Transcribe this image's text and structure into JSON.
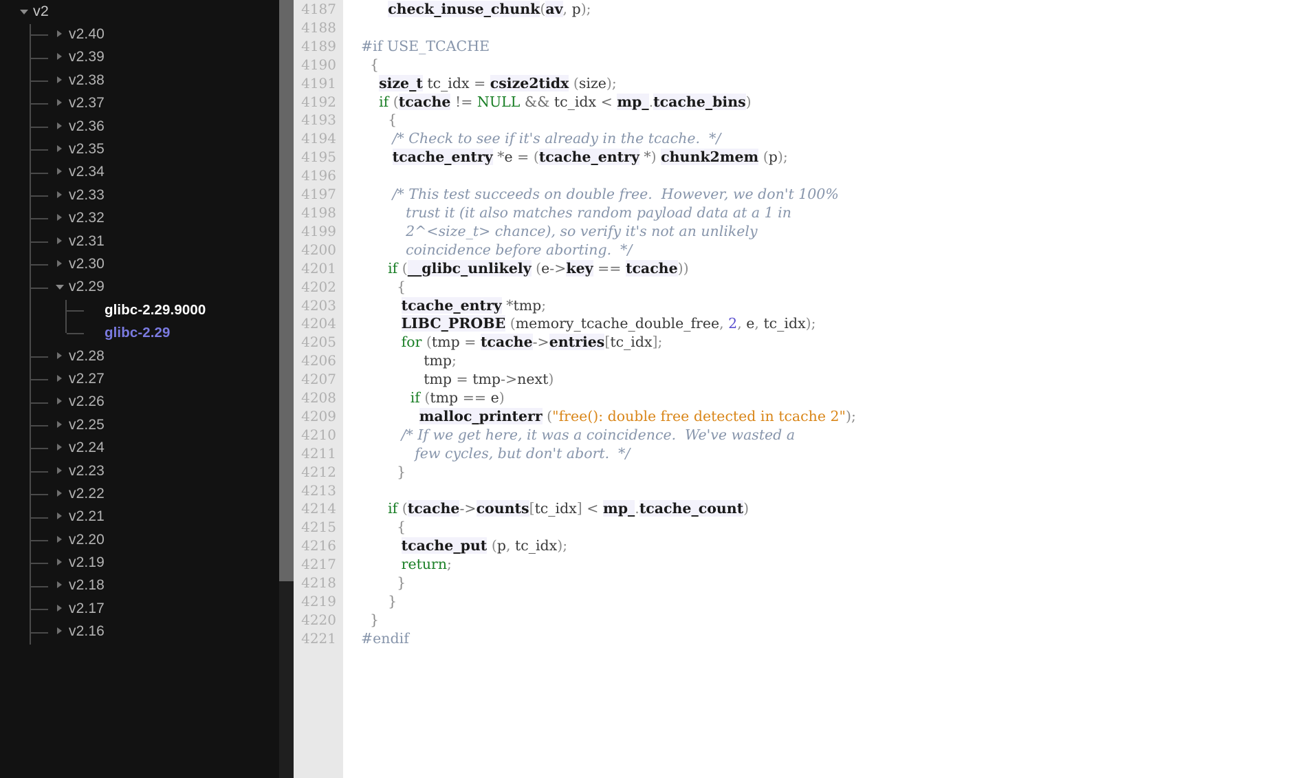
{
  "sidebar": {
    "name": "version-tree",
    "scrollbar": {
      "thumb_color": "#666666",
      "track_color": "#1f1f1f"
    },
    "items": [
      {
        "label": "v2",
        "depth": 0,
        "state": "open",
        "kind": "branch"
      },
      {
        "label": "v2.40",
        "depth": 1,
        "state": "closed",
        "kind": "branch"
      },
      {
        "label": "v2.39",
        "depth": 1,
        "state": "closed",
        "kind": "branch"
      },
      {
        "label": "v2.38",
        "depth": 1,
        "state": "closed",
        "kind": "branch"
      },
      {
        "label": "v2.37",
        "depth": 1,
        "state": "closed",
        "kind": "branch"
      },
      {
        "label": "v2.36",
        "depth": 1,
        "state": "closed",
        "kind": "branch"
      },
      {
        "label": "v2.35",
        "depth": 1,
        "state": "closed",
        "kind": "branch"
      },
      {
        "label": "v2.34",
        "depth": 1,
        "state": "closed",
        "kind": "branch"
      },
      {
        "label": "v2.33",
        "depth": 1,
        "state": "closed",
        "kind": "branch"
      },
      {
        "label": "v2.32",
        "depth": 1,
        "state": "closed",
        "kind": "branch"
      },
      {
        "label": "v2.31",
        "depth": 1,
        "state": "closed",
        "kind": "branch"
      },
      {
        "label": "v2.30",
        "depth": 1,
        "state": "closed",
        "kind": "branch"
      },
      {
        "label": "v2.29",
        "depth": 1,
        "state": "open",
        "kind": "branch"
      },
      {
        "label": "glibc-2.29.9000",
        "depth": 2,
        "state": "none",
        "kind": "leaf"
      },
      {
        "label": "glibc-2.29",
        "depth": 2,
        "state": "none",
        "kind": "leaf",
        "selected": true
      },
      {
        "label": "v2.28",
        "depth": 1,
        "state": "closed",
        "kind": "branch"
      },
      {
        "label": "v2.27",
        "depth": 1,
        "state": "closed",
        "kind": "branch"
      },
      {
        "label": "v2.26",
        "depth": 1,
        "state": "closed",
        "kind": "branch"
      },
      {
        "label": "v2.25",
        "depth": 1,
        "state": "closed",
        "kind": "branch"
      },
      {
        "label": "v2.24",
        "depth": 1,
        "state": "closed",
        "kind": "branch"
      },
      {
        "label": "v2.23",
        "depth": 1,
        "state": "closed",
        "kind": "branch"
      },
      {
        "label": "v2.22",
        "depth": 1,
        "state": "closed",
        "kind": "branch"
      },
      {
        "label": "v2.21",
        "depth": 1,
        "state": "closed",
        "kind": "branch"
      },
      {
        "label": "v2.20",
        "depth": 1,
        "state": "closed",
        "kind": "branch"
      },
      {
        "label": "v2.19",
        "depth": 1,
        "state": "closed",
        "kind": "branch"
      },
      {
        "label": "v2.18",
        "depth": 1,
        "state": "closed",
        "kind": "branch"
      },
      {
        "label": "v2.17",
        "depth": 1,
        "state": "closed",
        "kind": "branch"
      },
      {
        "label": "v2.16",
        "depth": 1,
        "state": "closed",
        "kind": "branch"
      }
    ]
  },
  "editor": {
    "first_line_number": 4187,
    "last_line_number": 4221,
    "colors": {
      "gutter_bg": "#e8e8e8",
      "line_number": "#b0b0b0",
      "code_bg": "#ffffff",
      "keyword": "#1a7f26",
      "preprocessor": "#8795ab",
      "comment": "#8795ab",
      "string": "#d98619",
      "number": "#5a4fcf",
      "identifier_bg": "#f3f2fb"
    },
    "lines": [
      {
        "n": 4187,
        "tokens": [
          {
            "t": "plain",
            "v": "      "
          },
          {
            "t": "id",
            "v": "check_inuse_chunk"
          },
          {
            "t": "punct",
            "v": "("
          },
          {
            "t": "id",
            "v": "av"
          },
          {
            "t": "punct",
            "v": ", "
          },
          {
            "t": "plain",
            "v": "p"
          },
          {
            "t": "punct",
            "v": ");"
          }
        ]
      },
      {
        "n": 4188,
        "tokens": []
      },
      {
        "n": 4189,
        "tokens": [
          {
            "t": "pre",
            "v": "#if USE_TCACHE"
          }
        ]
      },
      {
        "n": 4190,
        "tokens": [
          {
            "t": "punct",
            "v": "  {"
          }
        ]
      },
      {
        "n": 4191,
        "tokens": [
          {
            "t": "plain",
            "v": "    "
          },
          {
            "t": "id",
            "v": "size_t"
          },
          {
            "t": "plain",
            "v": " tc_idx "
          },
          {
            "t": "op",
            "v": "= "
          },
          {
            "t": "id",
            "v": "csize2tidx"
          },
          {
            "t": "plain",
            "v": " "
          },
          {
            "t": "punct",
            "v": "("
          },
          {
            "t": "plain",
            "v": "size"
          },
          {
            "t": "punct",
            "v": ");"
          }
        ]
      },
      {
        "n": 4192,
        "tokens": [
          {
            "t": "plain",
            "v": "    "
          },
          {
            "t": "kw",
            "v": "if"
          },
          {
            "t": "plain",
            "v": " "
          },
          {
            "t": "punct",
            "v": "("
          },
          {
            "t": "id",
            "v": "tcache"
          },
          {
            "t": "plain",
            "v": " "
          },
          {
            "t": "op",
            "v": "!= "
          },
          {
            "t": "kw",
            "v": "NULL"
          },
          {
            "t": "plain",
            "v": " "
          },
          {
            "t": "op",
            "v": "&& "
          },
          {
            "t": "plain",
            "v": "tc_idx "
          },
          {
            "t": "op",
            "v": "< "
          },
          {
            "t": "id",
            "v": "mp_"
          },
          {
            "t": "punct",
            "v": "."
          },
          {
            "t": "id",
            "v": "tcache_bins"
          },
          {
            "t": "punct",
            "v": ")"
          }
        ]
      },
      {
        "n": 4193,
        "tokens": [
          {
            "t": "punct",
            "v": "      {"
          }
        ]
      },
      {
        "n": 4194,
        "tokens": [
          {
            "t": "plain",
            "v": "       "
          },
          {
            "t": "cmt",
            "v": "/* Check to see if it's already in the tcache.  */"
          }
        ]
      },
      {
        "n": 4195,
        "tokens": [
          {
            "t": "plain",
            "v": "       "
          },
          {
            "t": "id",
            "v": "tcache_entry"
          },
          {
            "t": "plain",
            "v": " "
          },
          {
            "t": "op",
            "v": "*"
          },
          {
            "t": "plain",
            "v": "e "
          },
          {
            "t": "op",
            "v": "= "
          },
          {
            "t": "punct",
            "v": "("
          },
          {
            "t": "id",
            "v": "tcache_entry"
          },
          {
            "t": "plain",
            "v": " "
          },
          {
            "t": "op",
            "v": "*"
          },
          {
            "t": "punct",
            "v": ") "
          },
          {
            "t": "id",
            "v": "chunk2mem"
          },
          {
            "t": "plain",
            "v": " "
          },
          {
            "t": "punct",
            "v": "("
          },
          {
            "t": "plain",
            "v": "p"
          },
          {
            "t": "punct",
            "v": ");"
          }
        ]
      },
      {
        "n": 4196,
        "tokens": []
      },
      {
        "n": 4197,
        "tokens": [
          {
            "t": "plain",
            "v": "       "
          },
          {
            "t": "cmt",
            "v": "/* This test succeeds on double free.  However, we don't 100%"
          }
        ]
      },
      {
        "n": 4198,
        "tokens": [
          {
            "t": "plain",
            "v": "          "
          },
          {
            "t": "cmt",
            "v": "trust it (it also matches random payload data at a 1 in"
          }
        ]
      },
      {
        "n": 4199,
        "tokens": [
          {
            "t": "plain",
            "v": "          "
          },
          {
            "t": "cmt",
            "v": "2^<size_t> chance), so verify it's not an unlikely"
          }
        ]
      },
      {
        "n": 4200,
        "tokens": [
          {
            "t": "plain",
            "v": "          "
          },
          {
            "t": "cmt",
            "v": "coincidence before aborting.  */"
          }
        ]
      },
      {
        "n": 4201,
        "tokens": [
          {
            "t": "plain",
            "v": "      "
          },
          {
            "t": "kw",
            "v": "if"
          },
          {
            "t": "plain",
            "v": " "
          },
          {
            "t": "punct",
            "v": "("
          },
          {
            "t": "id",
            "v": "__glibc_unlikely"
          },
          {
            "t": "plain",
            "v": " "
          },
          {
            "t": "punct",
            "v": "("
          },
          {
            "t": "plain",
            "v": "e"
          },
          {
            "t": "op",
            "v": "->"
          },
          {
            "t": "id",
            "v": "key"
          },
          {
            "t": "plain",
            "v": " "
          },
          {
            "t": "op",
            "v": "== "
          },
          {
            "t": "id",
            "v": "tcache"
          },
          {
            "t": "punct",
            "v": "))"
          }
        ]
      },
      {
        "n": 4202,
        "tokens": [
          {
            "t": "punct",
            "v": "        {"
          }
        ]
      },
      {
        "n": 4203,
        "tokens": [
          {
            "t": "plain",
            "v": "         "
          },
          {
            "t": "id",
            "v": "tcache_entry"
          },
          {
            "t": "plain",
            "v": " "
          },
          {
            "t": "op",
            "v": "*"
          },
          {
            "t": "plain",
            "v": "tmp"
          },
          {
            "t": "punct",
            "v": ";"
          }
        ]
      },
      {
        "n": 4204,
        "tokens": [
          {
            "t": "plain",
            "v": "         "
          },
          {
            "t": "id",
            "v": "LIBC_PROBE"
          },
          {
            "t": "plain",
            "v": " "
          },
          {
            "t": "punct",
            "v": "("
          },
          {
            "t": "plain",
            "v": "memory_tcache_double_free"
          },
          {
            "t": "punct",
            "v": ", "
          },
          {
            "t": "num",
            "v": "2"
          },
          {
            "t": "punct",
            "v": ", "
          },
          {
            "t": "plain",
            "v": "e"
          },
          {
            "t": "punct",
            "v": ", "
          },
          {
            "t": "plain",
            "v": "tc_idx"
          },
          {
            "t": "punct",
            "v": ");"
          }
        ]
      },
      {
        "n": 4205,
        "tokens": [
          {
            "t": "plain",
            "v": "         "
          },
          {
            "t": "kw",
            "v": "for"
          },
          {
            "t": "plain",
            "v": " "
          },
          {
            "t": "punct",
            "v": "("
          },
          {
            "t": "plain",
            "v": "tmp "
          },
          {
            "t": "op",
            "v": "= "
          },
          {
            "t": "id",
            "v": "tcache"
          },
          {
            "t": "op",
            "v": "->"
          },
          {
            "t": "id",
            "v": "entries"
          },
          {
            "t": "punct",
            "v": "["
          },
          {
            "t": "plain",
            "v": "tc_idx"
          },
          {
            "t": "punct",
            "v": "];"
          }
        ]
      },
      {
        "n": 4206,
        "tokens": [
          {
            "t": "plain",
            "v": "              tmp"
          },
          {
            "t": "punct",
            "v": ";"
          }
        ]
      },
      {
        "n": 4207,
        "tokens": [
          {
            "t": "plain",
            "v": "              tmp "
          },
          {
            "t": "op",
            "v": "= "
          },
          {
            "t": "plain",
            "v": "tmp"
          },
          {
            "t": "op",
            "v": "->"
          },
          {
            "t": "plain",
            "v": "next"
          },
          {
            "t": "punct",
            "v": ")"
          }
        ]
      },
      {
        "n": 4208,
        "tokens": [
          {
            "t": "plain",
            "v": "           "
          },
          {
            "t": "kw",
            "v": "if"
          },
          {
            "t": "plain",
            "v": " "
          },
          {
            "t": "punct",
            "v": "("
          },
          {
            "t": "plain",
            "v": "tmp "
          },
          {
            "t": "op",
            "v": "== "
          },
          {
            "t": "plain",
            "v": "e"
          },
          {
            "t": "punct",
            "v": ")"
          }
        ]
      },
      {
        "n": 4209,
        "tokens": [
          {
            "t": "plain",
            "v": "             "
          },
          {
            "t": "id",
            "v": "malloc_printerr"
          },
          {
            "t": "plain",
            "v": " "
          },
          {
            "t": "punct",
            "v": "("
          },
          {
            "t": "str",
            "v": "\"free(): double free detected in tcache 2\""
          },
          {
            "t": "punct",
            "v": ");"
          }
        ]
      },
      {
        "n": 4210,
        "tokens": [
          {
            "t": "plain",
            "v": "         "
          },
          {
            "t": "cmt",
            "v": "/* If we get here, it was a coincidence.  We've wasted a"
          }
        ]
      },
      {
        "n": 4211,
        "tokens": [
          {
            "t": "plain",
            "v": "            "
          },
          {
            "t": "cmt",
            "v": "few cycles, but don't abort.  */"
          }
        ]
      },
      {
        "n": 4212,
        "tokens": [
          {
            "t": "punct",
            "v": "        }"
          }
        ]
      },
      {
        "n": 4213,
        "tokens": []
      },
      {
        "n": 4214,
        "tokens": [
          {
            "t": "plain",
            "v": "      "
          },
          {
            "t": "kw",
            "v": "if"
          },
          {
            "t": "plain",
            "v": " "
          },
          {
            "t": "punct",
            "v": "("
          },
          {
            "t": "id",
            "v": "tcache"
          },
          {
            "t": "op",
            "v": "->"
          },
          {
            "t": "id",
            "v": "counts"
          },
          {
            "t": "punct",
            "v": "["
          },
          {
            "t": "plain",
            "v": "tc_idx"
          },
          {
            "t": "punct",
            "v": "] "
          },
          {
            "t": "op",
            "v": "< "
          },
          {
            "t": "id",
            "v": "mp_"
          },
          {
            "t": "punct",
            "v": "."
          },
          {
            "t": "id",
            "v": "tcache_count"
          },
          {
            "t": "punct",
            "v": ")"
          }
        ]
      },
      {
        "n": 4215,
        "tokens": [
          {
            "t": "punct",
            "v": "        {"
          }
        ]
      },
      {
        "n": 4216,
        "tokens": [
          {
            "t": "plain",
            "v": "         "
          },
          {
            "t": "id",
            "v": "tcache_put"
          },
          {
            "t": "plain",
            "v": " "
          },
          {
            "t": "punct",
            "v": "("
          },
          {
            "t": "plain",
            "v": "p"
          },
          {
            "t": "punct",
            "v": ", "
          },
          {
            "t": "plain",
            "v": "tc_idx"
          },
          {
            "t": "punct",
            "v": ");"
          }
        ]
      },
      {
        "n": 4217,
        "tokens": [
          {
            "t": "plain",
            "v": "         "
          },
          {
            "t": "kw",
            "v": "return"
          },
          {
            "t": "punct",
            "v": ";"
          }
        ]
      },
      {
        "n": 4218,
        "tokens": [
          {
            "t": "punct",
            "v": "        }"
          }
        ]
      },
      {
        "n": 4219,
        "tokens": [
          {
            "t": "punct",
            "v": "      }"
          }
        ]
      },
      {
        "n": 4220,
        "tokens": [
          {
            "t": "punct",
            "v": "  }"
          }
        ]
      },
      {
        "n": 4221,
        "tokens": [
          {
            "t": "pre",
            "v": "#endif"
          }
        ]
      }
    ]
  }
}
